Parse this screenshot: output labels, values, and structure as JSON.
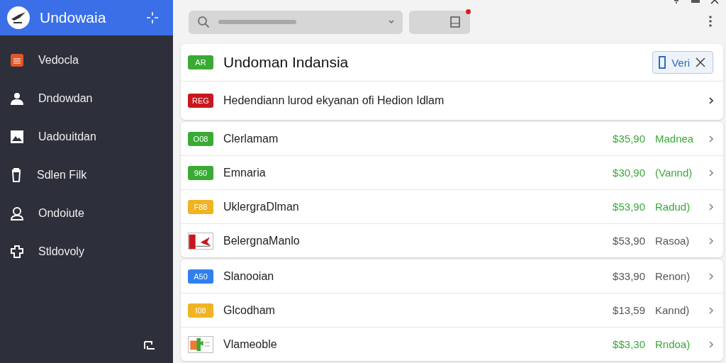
{
  "sidebar": {
    "title": "Undowaia",
    "items": [
      {
        "label": "Vedocla"
      },
      {
        "label": "Dndowdan"
      },
      {
        "label": "Uadouitdan"
      },
      {
        "label": "Sdlen Filk"
      },
      {
        "label": "Ondoiute"
      },
      {
        "label": "Stldovoly"
      }
    ]
  },
  "toolbar": {
    "notification": true
  },
  "groups": [
    {
      "rows": [
        {
          "kind": "header",
          "marker": {
            "kind": "badge",
            "label": "AR",
            "color": "#3aaa35"
          },
          "title": "Undoman Indansia",
          "chip": "Veri"
        },
        {
          "kind": "link",
          "marker": {
            "kind": "badge",
            "label": "REG",
            "color": "#c8171e"
          },
          "title": "Hedendiann lurod ekyanan ofi Hedion Idlam"
        }
      ]
    },
    {
      "rows": [
        {
          "kind": "item",
          "marker": {
            "kind": "badge",
            "label": "O08",
            "color": "#3aaa35"
          },
          "title": "Clerlamam",
          "amount": {
            "price": "$35,90",
            "status": "Madnea",
            "color": "#3aa83a"
          }
        },
        {
          "kind": "item",
          "marker": {
            "kind": "badge",
            "label": "960",
            "color": "#3aaa35"
          },
          "title": "Emnaria",
          "amount": {
            "price": "$30,90",
            "status": "(Vannd)",
            "color": "#3aa83a"
          }
        },
        {
          "kind": "item",
          "marker": {
            "kind": "badge",
            "label": "F88",
            "color": "#f0b323"
          },
          "title": "UklergraDlman",
          "amount": {
            "price": "$53,90",
            "status": "Radud)",
            "color": "#3aa83a"
          }
        },
        {
          "kind": "item",
          "title": "BelergnaManlo",
          "amount": {
            "price": "$53,90",
            "status": "Rasoa)",
            "color": "#555555"
          }
        }
      ]
    },
    {
      "rows": [
        {
          "kind": "item",
          "marker": {
            "kind": "badge",
            "label": "A50",
            "color": "#2f80ed"
          },
          "title": "Slanooian",
          "amount": {
            "price": "$33,90",
            "status": "Renon)",
            "color": "#555555"
          }
        },
        {
          "kind": "item",
          "marker": {
            "kind": "badge",
            "label": "I08",
            "color": "#f0b323"
          },
          "title": "Glcodham",
          "amount": {
            "price": "$13,59",
            "status": "Kannd)",
            "color": "#555555"
          }
        },
        {
          "kind": "item",
          "title": "Vlameoble",
          "amount": {
            "price": "$$3,30",
            "status": "Rndoa)",
            "color": "#3aa83a"
          }
        }
      ]
    }
  ]
}
